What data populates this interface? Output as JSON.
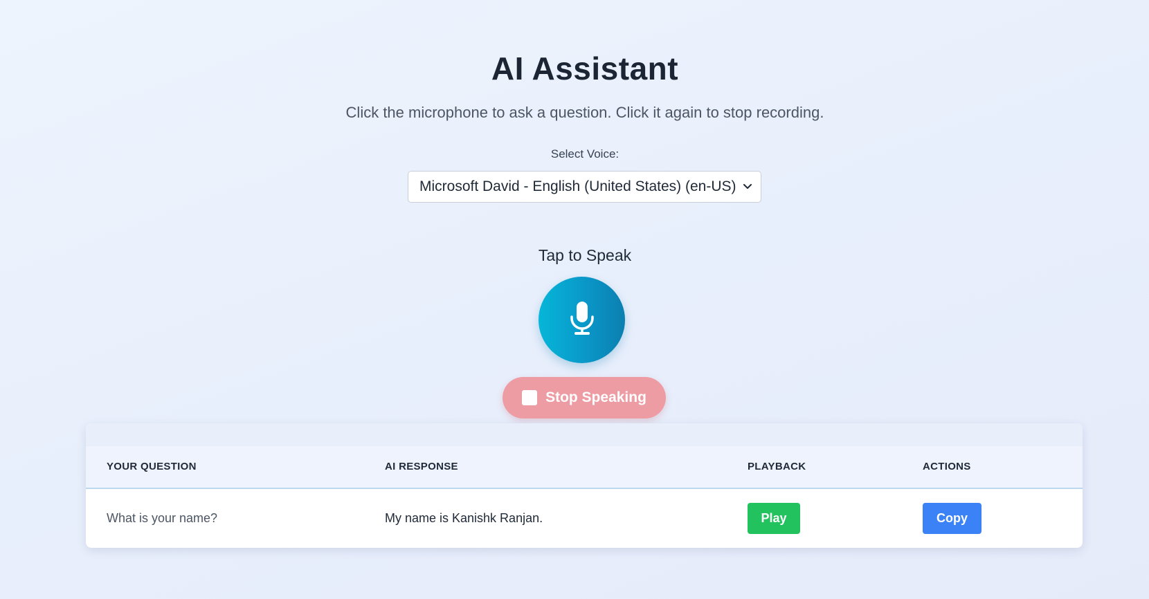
{
  "header": {
    "title": "AI Assistant",
    "subtitle": "Click the microphone to ask a question. Click it again to stop recording."
  },
  "voice": {
    "label": "Select Voice:",
    "selected": "Microsoft David - English (United States) (en-US)"
  },
  "recorder": {
    "tap_label": "Tap to Speak",
    "mic_icon": "microphone-icon",
    "stop_label": "Stop Speaking",
    "stop_icon": "stop-square-icon"
  },
  "table": {
    "columns": [
      "YOUR QUESTION",
      "AI RESPONSE",
      "PLAYBACK",
      "ACTIONS"
    ],
    "rows": [
      {
        "question": "What is your name?",
        "response": "My name is Kanishk Ranjan.",
        "play_label": "Play",
        "copy_label": "Copy"
      }
    ]
  },
  "colors": {
    "mic_gradient_start": "#06b6d8",
    "mic_gradient_end": "#0b7fb0",
    "stop_button": "#ee9ca3",
    "play_button": "#22c35e",
    "copy_button": "#3b82f6"
  }
}
